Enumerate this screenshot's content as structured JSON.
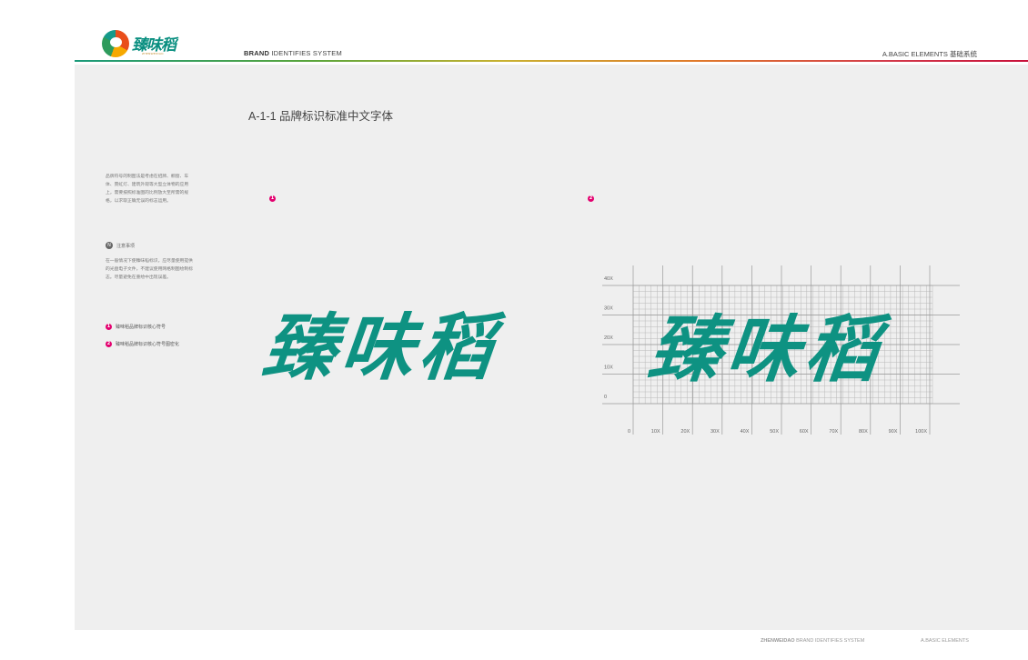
{
  "header": {
    "brand_name": "臻味稻",
    "brand_sub": "ZHENWEIDAO",
    "left_bold": "BRAND",
    "left_rest": " IDENTIFIES SYSTEM",
    "right": "A.BASIC ELEMENTS  基础系统"
  },
  "section_title": "A-1-1   品牌标识标准中文字体",
  "sidebar": {
    "description": "品牌符号的制图法是考虑在招牌、橱窗、车体、霓虹灯、建筑外观等大型立体物的应用上，需要按照标准图的比例放大至所需的规格，以求取正确无误的标志运用。",
    "note_icon": "N",
    "note_title": "注意事项",
    "note_body": "在一般情况下使臻味稻标识，应尽量使用提供的光盘电子文件，不建议使用网格制图绘制标志。尽量避免在重绘中出现误差。",
    "legend": [
      {
        "num": "1",
        "label": "臻味稻品牌标识核心符号"
      },
      {
        "num": "2",
        "label": "臻味稻品牌标识核心符号图密化"
      }
    ]
  },
  "figures": [
    {
      "num": "1",
      "wordmark": "臻味稻"
    },
    {
      "num": "2",
      "wordmark": "臻味稻"
    }
  ],
  "grid": {
    "y_labels": [
      "40X",
      "30X",
      "20X",
      "10X",
      "0"
    ],
    "x_labels": [
      "0",
      "10X",
      "20X",
      "30X",
      "40X",
      "50X",
      "60X",
      "70X",
      "80X",
      "90X",
      "100X"
    ]
  },
  "footer": {
    "left_bold": "ZHENWEIDAO",
    "left_rest": " BRAND IDENTIFIES SYSTEM",
    "right": "A.BASIC ELEMENTS"
  },
  "colors": {
    "brand_teal": "#0e9282",
    "marker_pink": "#e3006f",
    "panel_bg": "#efefef"
  }
}
